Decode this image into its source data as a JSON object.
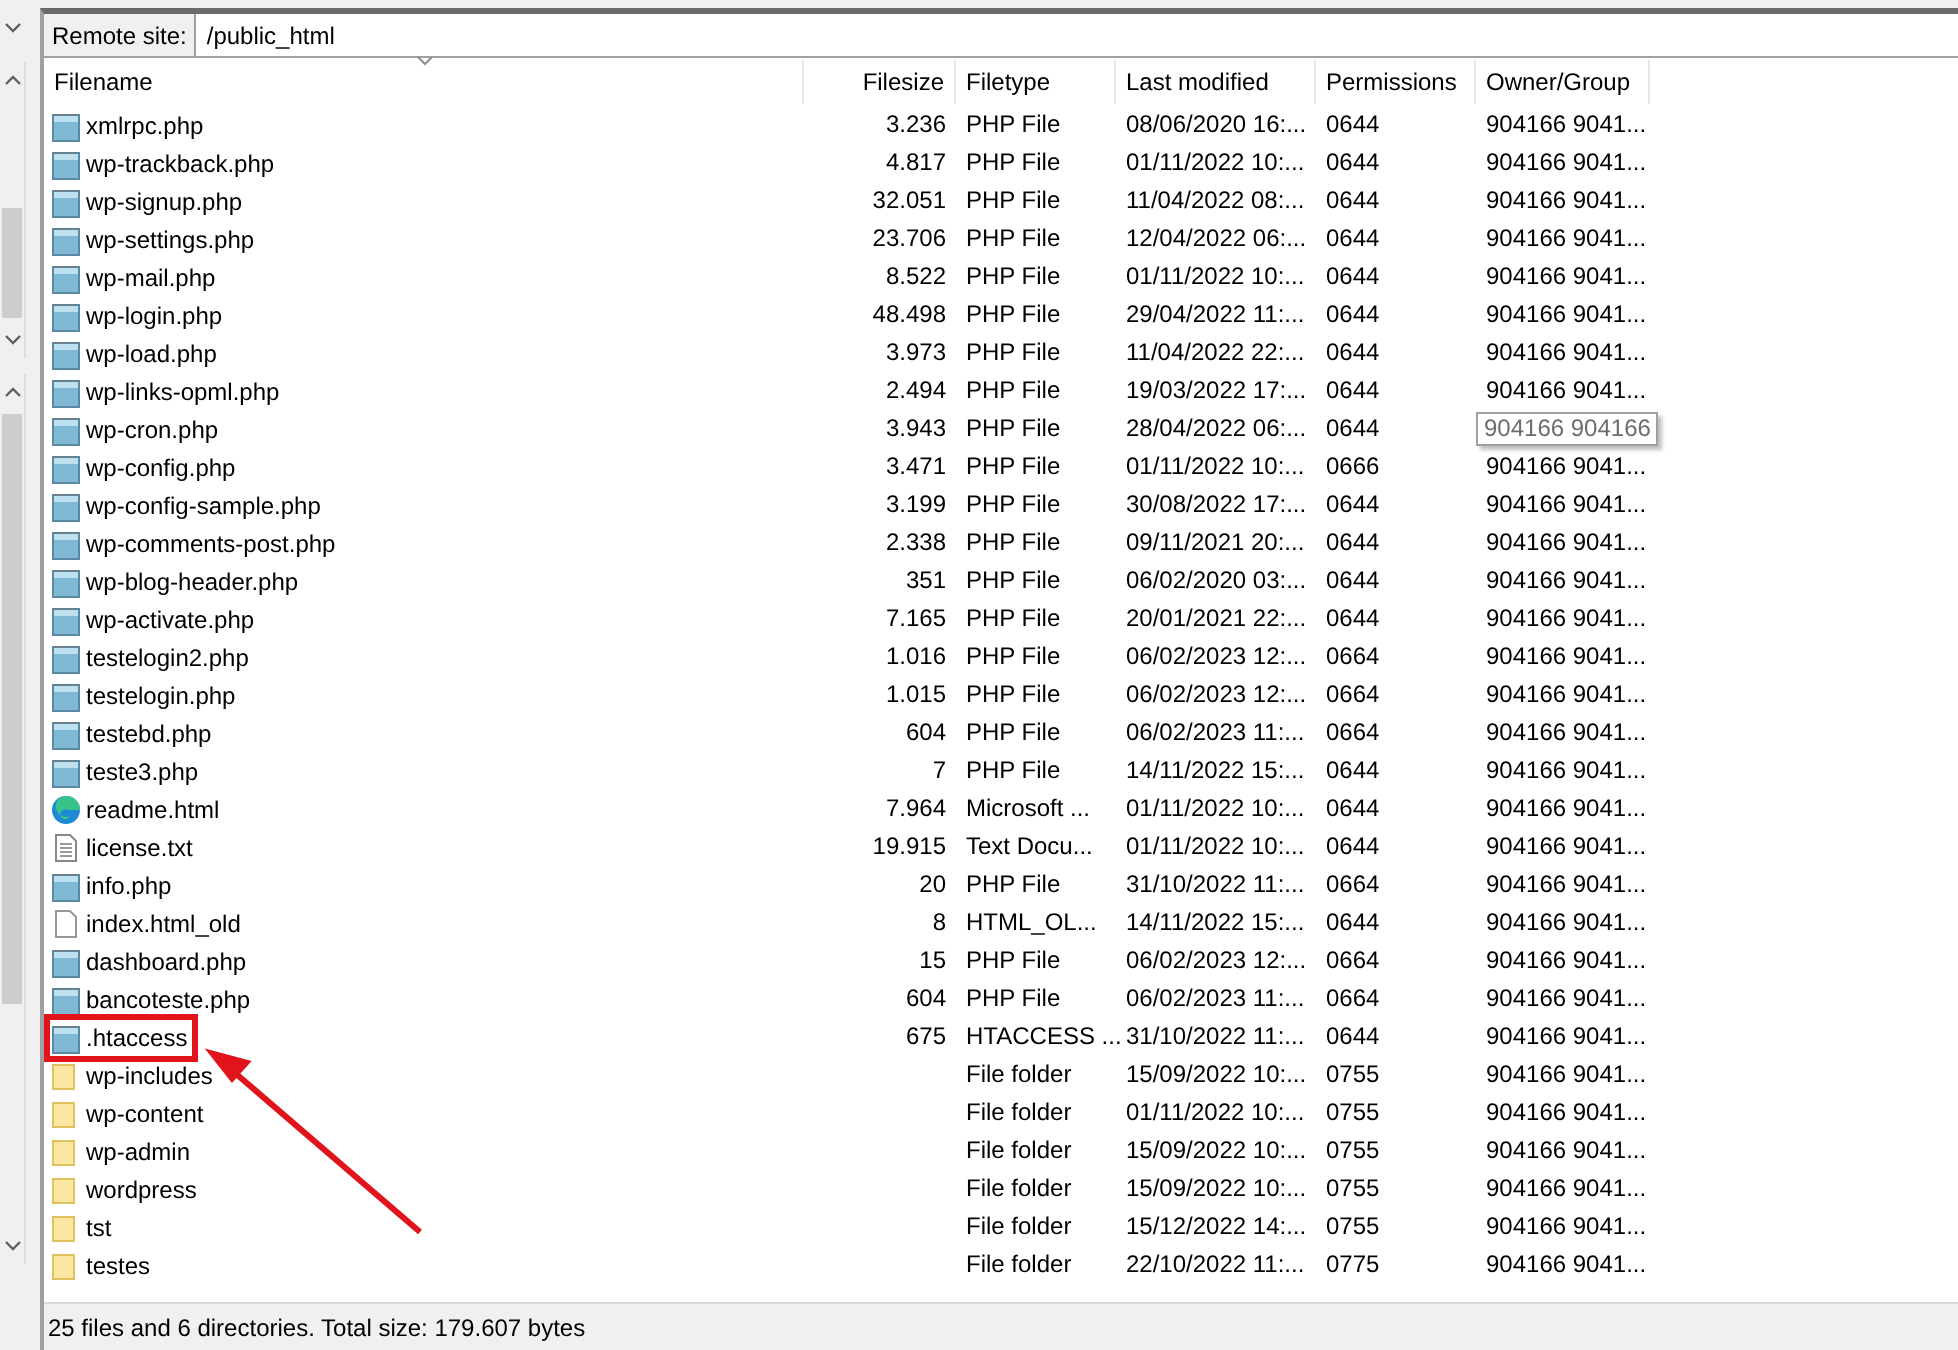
{
  "remote_site": {
    "label": "Remote site:",
    "path": "/public_html"
  },
  "columns": [
    "Filename",
    "Filesize",
    "Filetype",
    "Last modified",
    "Permissions",
    "Owner/Group"
  ],
  "rows": [
    {
      "kind": "php",
      "name": "xmlrpc.php",
      "size": "3.236",
      "type": "PHP File",
      "modified": "08/06/2020 16:...",
      "perms": "0644",
      "owner": "904166 9041...",
      "highlighted": false
    },
    {
      "kind": "php",
      "name": "wp-trackback.php",
      "size": "4.817",
      "type": "PHP File",
      "modified": "01/11/2022 10:...",
      "perms": "0644",
      "owner": "904166 9041...",
      "highlighted": false
    },
    {
      "kind": "php",
      "name": "wp-signup.php",
      "size": "32.051",
      "type": "PHP File",
      "modified": "11/04/2022 08:...",
      "perms": "0644",
      "owner": "904166 9041...",
      "highlighted": false
    },
    {
      "kind": "php",
      "name": "wp-settings.php",
      "size": "23.706",
      "type": "PHP File",
      "modified": "12/04/2022 06:...",
      "perms": "0644",
      "owner": "904166 9041...",
      "highlighted": false
    },
    {
      "kind": "php",
      "name": "wp-mail.php",
      "size": "8.522",
      "type": "PHP File",
      "modified": "01/11/2022 10:...",
      "perms": "0644",
      "owner": "904166 9041...",
      "highlighted": false
    },
    {
      "kind": "php",
      "name": "wp-login.php",
      "size": "48.498",
      "type": "PHP File",
      "modified": "29/04/2022 11:...",
      "perms": "0644",
      "owner": "904166 9041...",
      "highlighted": false
    },
    {
      "kind": "php",
      "name": "wp-load.php",
      "size": "3.973",
      "type": "PHP File",
      "modified": "11/04/2022 22:...",
      "perms": "0644",
      "owner": "904166 9041...",
      "highlighted": false
    },
    {
      "kind": "php",
      "name": "wp-links-opml.php",
      "size": "2.494",
      "type": "PHP File",
      "modified": "19/03/2022 17:...",
      "perms": "0644",
      "owner": "904166 9041...",
      "highlighted": false
    },
    {
      "kind": "php",
      "name": "wp-cron.php",
      "size": "3.943",
      "type": "PHP File",
      "modified": "28/04/2022 06:...",
      "perms": "0644",
      "tooltip": "904166 904166",
      "highlighted": false
    },
    {
      "kind": "php",
      "name": "wp-config.php",
      "size": "3.471",
      "type": "PHP File",
      "modified": "01/11/2022 10:...",
      "perms": "0666",
      "owner": "904166 9041...",
      "highlighted": false
    },
    {
      "kind": "php",
      "name": "wp-config-sample.php",
      "size": "3.199",
      "type": "PHP File",
      "modified": "30/08/2022 17:...",
      "perms": "0644",
      "owner": "904166 9041...",
      "highlighted": false
    },
    {
      "kind": "php",
      "name": "wp-comments-post.php",
      "size": "2.338",
      "type": "PHP File",
      "modified": "09/11/2021 20:...",
      "perms": "0644",
      "owner": "904166 9041...",
      "highlighted": false
    },
    {
      "kind": "php",
      "name": "wp-blog-header.php",
      "size": "351",
      "type": "PHP File",
      "modified": "06/02/2020 03:...",
      "perms": "0644",
      "owner": "904166 9041...",
      "highlighted": false
    },
    {
      "kind": "php",
      "name": "wp-activate.php",
      "size": "7.165",
      "type": "PHP File",
      "modified": "20/01/2021 22:...",
      "perms": "0644",
      "owner": "904166 9041...",
      "highlighted": false
    },
    {
      "kind": "php",
      "name": "testelogin2.php",
      "size": "1.016",
      "type": "PHP File",
      "modified": "06/02/2023 12:...",
      "perms": "0664",
      "owner": "904166 9041...",
      "highlighted": false
    },
    {
      "kind": "php",
      "name": "testelogin.php",
      "size": "1.015",
      "type": "PHP File",
      "modified": "06/02/2023 12:...",
      "perms": "0664",
      "owner": "904166 9041...",
      "highlighted": false
    },
    {
      "kind": "php",
      "name": "testebd.php",
      "size": "604",
      "type": "PHP File",
      "modified": "06/02/2023 11:...",
      "perms": "0664",
      "owner": "904166 9041...",
      "highlighted": false
    },
    {
      "kind": "php",
      "name": "teste3.php",
      "size": "7",
      "type": "PHP File",
      "modified": "14/11/2022 15:...",
      "perms": "0644",
      "owner": "904166 9041...",
      "highlighted": false
    },
    {
      "kind": "browser",
      "name": "readme.html",
      "size": "7.964",
      "type": "Microsoft ...",
      "modified": "01/11/2022 10:...",
      "perms": "0644",
      "owner": "904166 9041...",
      "highlighted": false
    },
    {
      "kind": "text",
      "name": "license.txt",
      "size": "19.915",
      "type": "Text Docu...",
      "modified": "01/11/2022 10:...",
      "perms": "0644",
      "owner": "904166 9041...",
      "highlighted": false
    },
    {
      "kind": "php",
      "name": "info.php",
      "size": "20",
      "type": "PHP File",
      "modified": "31/10/2022 11:...",
      "perms": "0664",
      "owner": "904166 9041...",
      "highlighted": false
    },
    {
      "kind": "blank",
      "name": "index.html_old",
      "size": "8",
      "type": "HTML_OL...",
      "modified": "14/11/2022 15:...",
      "perms": "0644",
      "owner": "904166 9041...",
      "highlighted": false
    },
    {
      "kind": "php",
      "name": "dashboard.php",
      "size": "15",
      "type": "PHP File",
      "modified": "06/02/2023 12:...",
      "perms": "0664",
      "owner": "904166 9041...",
      "highlighted": false
    },
    {
      "kind": "php",
      "name": "bancoteste.php",
      "size": "604",
      "type": "PHP File",
      "modified": "06/02/2023 11:...",
      "perms": "0664",
      "owner": "904166 9041...",
      "highlighted": false
    },
    {
      "kind": "php",
      "name": ".htaccess",
      "size": "675",
      "type": "HTACCESS ...",
      "modified": "31/10/2022 11:...",
      "perms": "0644",
      "owner": "904166 9041...",
      "highlighted": true
    },
    {
      "kind": "folder",
      "name": "wp-includes",
      "type": "File folder",
      "modified": "15/09/2022 10:...",
      "perms": "0755",
      "owner": "904166 9041...",
      "highlighted": false
    },
    {
      "kind": "folder",
      "name": "wp-content",
      "type": "File folder",
      "modified": "01/11/2022 10:...",
      "perms": "0755",
      "owner": "904166 9041...",
      "highlighted": false
    },
    {
      "kind": "folder",
      "name": "wp-admin",
      "type": "File folder",
      "modified": "15/09/2022 10:...",
      "perms": "0755",
      "owner": "904166 9041...",
      "highlighted": false
    },
    {
      "kind": "folder",
      "name": "wordpress",
      "type": "File folder",
      "modified": "15/09/2022 10:...",
      "perms": "0755",
      "owner": "904166 9041...",
      "highlighted": false
    },
    {
      "kind": "folder",
      "name": "tst",
      "type": "File folder",
      "modified": "15/12/2022 14:...",
      "perms": "0755",
      "owner": "904166 9041...",
      "highlighted": false
    },
    {
      "kind": "folder",
      "name": "testes",
      "type": "File folder",
      "modified": "22/10/2022 11:...",
      "perms": "0775",
      "owner": "904166 9041...",
      "highlighted": false
    }
  ],
  "status_bar": "25 files and 6 directories. Total size: 179.607 bytes"
}
